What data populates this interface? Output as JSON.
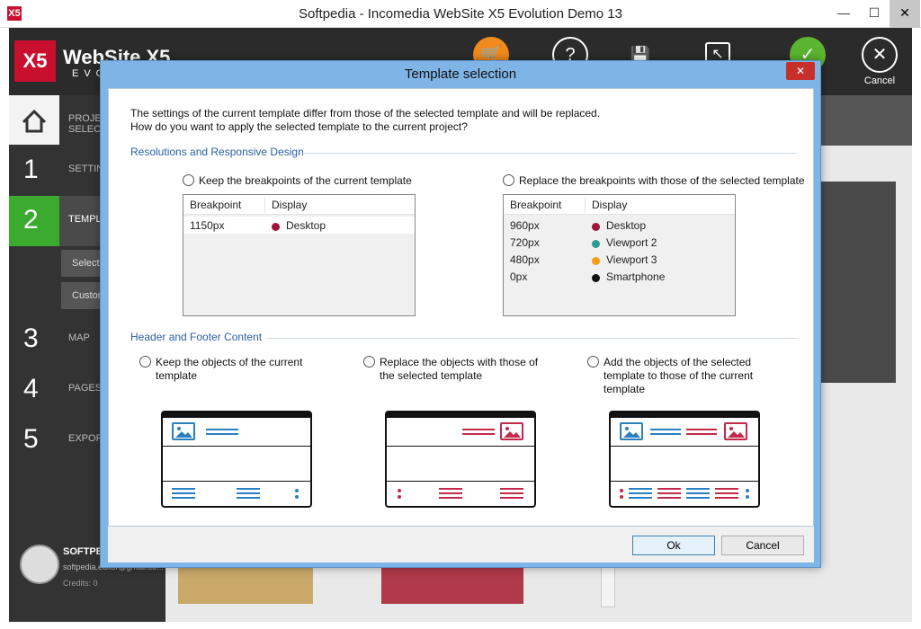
{
  "window": {
    "title": "Softpedia - Incomedia WebSite X5 Evolution Demo 13",
    "app_icon": "X5",
    "minimize": "—",
    "maximize": "☐",
    "close": "✕"
  },
  "app": {
    "logo_mark": "X5",
    "logo_text": "WebSite X5",
    "logo_sub": "EVO",
    "cancel_label": "Cancel",
    "colors": {
      "brand": "#c8102e",
      "cart": "#f08a1c",
      "confirm": "#5cb531"
    }
  },
  "sidebar": {
    "steps": [
      {
        "num": "",
        "label": "PROJECT SELECTION"
      },
      {
        "num": "1",
        "label": "SETTINGS"
      },
      {
        "num": "2",
        "label": "TEMPLATE"
      },
      {
        "num": "3",
        "label": "MAP"
      },
      {
        "num": "4",
        "label": "PAGES"
      },
      {
        "num": "5",
        "label": "EXPORT"
      }
    ],
    "sub_items": [
      "Select",
      "Custom"
    ],
    "profile": {
      "name": "SOFTPEDIA",
      "email": "softpedia.editor@gmail.co...",
      "credits": "Credits: 0"
    },
    "active_color": "#3aab2f"
  },
  "dialog": {
    "title": "Template selection",
    "intro_line1": "The settings of the current template differ from those of the selected template and will be replaced.",
    "intro_line2": "How do you want to apply the selected template to the current project?",
    "section1_title": "Resolutions and Responsive Design",
    "keep_breakpoints": "Keep the breakpoints of the current template",
    "replace_breakpoints": "Replace the breakpoints with those of the selected template",
    "table_headers": {
      "breakpoint": "Breakpoint",
      "display": "Display"
    },
    "current_breakpoints": [
      {
        "px": "1150px",
        "name": "Desktop",
        "color": "#a3143a"
      }
    ],
    "selected_breakpoints": [
      {
        "px": "960px",
        "name": "Desktop",
        "color": "#a3143a"
      },
      {
        "px": "720px",
        "name": "Viewport 2",
        "color": "#2a9d8f"
      },
      {
        "px": "480px",
        "name": "Viewport 3",
        "color": "#f39c12"
      },
      {
        "px": "0px",
        "name": "Smartphone",
        "color": "#111111"
      }
    ],
    "section2_title": "Header and Footer Content",
    "keep_objects_1": "Keep the objects of the current",
    "keep_objects_2": "template",
    "replace_objects_1": "Replace the objects with those of",
    "replace_objects_2": "the selected template",
    "add_objects_1": "Add the objects of the selected",
    "add_objects_2": "template to those of the current",
    "add_objects_3": "template",
    "ok": "Ok",
    "cancel": "Cancel",
    "colors": {
      "current": "#2a7fc1",
      "selected": "#c4284a"
    }
  }
}
